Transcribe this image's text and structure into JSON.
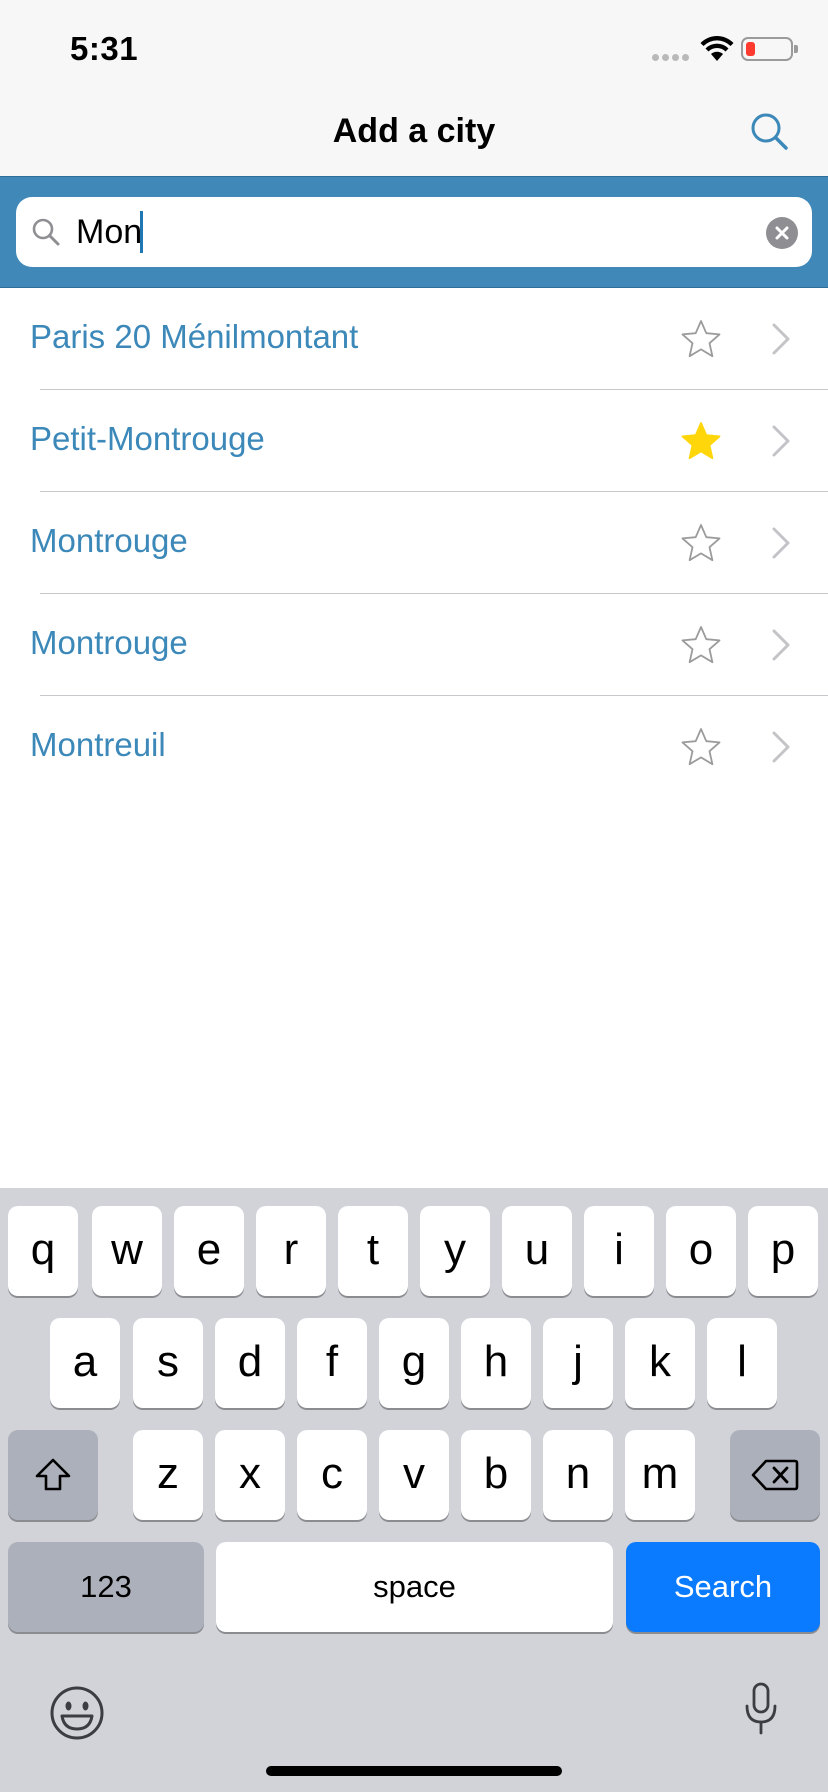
{
  "status_bar": {
    "time": "5:31"
  },
  "nav": {
    "title": "Add a city"
  },
  "search": {
    "value": "Mon",
    "placeholder": ""
  },
  "results": [
    {
      "city": "Paris 20 Ménilmontant",
      "favorite": false
    },
    {
      "city": "Petit-Montrouge",
      "favorite": true
    },
    {
      "city": "Montrouge",
      "favorite": false
    },
    {
      "city": "Montrouge",
      "favorite": false
    },
    {
      "city": "Montreuil",
      "favorite": false
    }
  ],
  "keyboard": {
    "row1": [
      "q",
      "w",
      "e",
      "r",
      "t",
      "y",
      "u",
      "i",
      "o",
      "p"
    ],
    "row2": [
      "a",
      "s",
      "d",
      "f",
      "g",
      "h",
      "j",
      "k",
      "l"
    ],
    "row3": [
      "z",
      "x",
      "c",
      "v",
      "b",
      "n",
      "m"
    ],
    "numbers_label": "123",
    "space_label": "space",
    "search_label": "Search"
  },
  "colors": {
    "accent": "#3b88b9",
    "search_strip": "#3f88b8",
    "star_filled": "#ffd60a",
    "search_key": "#0a7aff"
  }
}
